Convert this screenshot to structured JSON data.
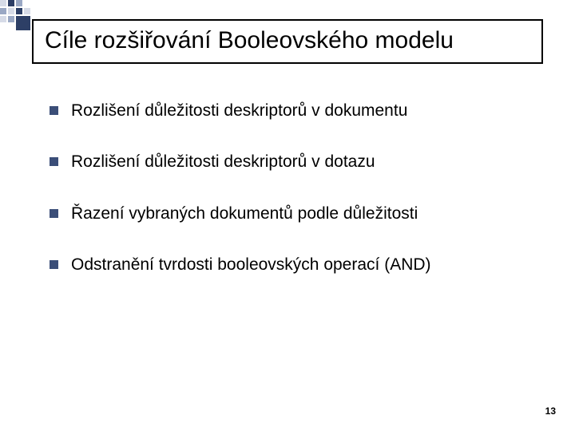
{
  "title": "Cíle rozšiřování Booleovského modelu",
  "bullets": [
    "Rozlišení důležitosti deskriptorů v dokumentu",
    "Rozlišení důležitosti deskriptorů v dotazu",
    "Řazení vybraných dokumentů podle důležitosti",
    "Odstranění tvrdosti booleovských operací (AND)"
  ],
  "page_number": "13",
  "colors": {
    "bullet_square": "#3b4e78",
    "deco_dark": "#2d3f66",
    "deco_mid": "#9aa8c4",
    "deco_light": "#d6dbe7"
  }
}
